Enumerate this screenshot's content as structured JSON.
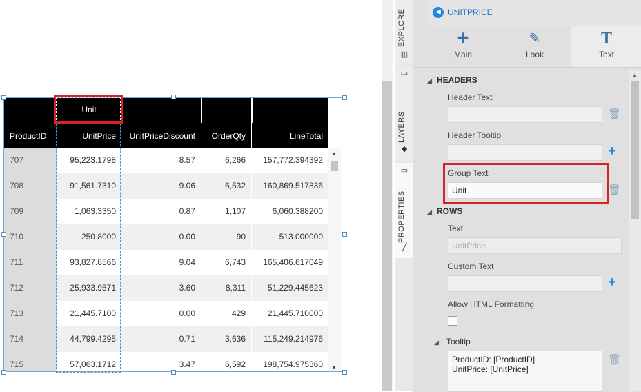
{
  "grid": {
    "group_header": "Unit",
    "columns": [
      "ProductID",
      "UnitPrice",
      "UnitPriceDiscount",
      "OrderQty",
      "LineTotal"
    ],
    "rows": [
      [
        "707",
        "95,223.1798",
        "8.57",
        "6,266",
        "157,772.394392"
      ],
      [
        "708",
        "91,561.7310",
        "9.06",
        "6,532",
        "160,869.517836"
      ],
      [
        "709",
        "1,063.3350",
        "0.87",
        "1,107",
        "6,060.388200"
      ],
      [
        "710",
        "250.8000",
        "0.00",
        "90",
        "513.000000"
      ],
      [
        "711",
        "93,827.8566",
        "9.04",
        "6,743",
        "165,406.617049"
      ],
      [
        "712",
        "25,933.9571",
        "3.60",
        "8,311",
        "51,229.445623"
      ],
      [
        "713",
        "21,445.7100",
        "0.00",
        "429",
        "21,445.710000"
      ],
      [
        "714",
        "44,799.4295",
        "0.71",
        "3,636",
        "115,249.214976"
      ],
      [
        "715",
        "57,063.1712",
        "3.47",
        "6,592",
        "198,754.975360"
      ]
    ]
  },
  "side_tabs": {
    "explore": "EXPLORE",
    "layers": "LAYERS",
    "properties": "PROPERTIES"
  },
  "panel": {
    "breadcrumb": "UNITPRICE",
    "tabs": [
      {
        "label": "Main",
        "icon": "puzzle-icon"
      },
      {
        "label": "Look",
        "icon": "eye-brush-icon"
      },
      {
        "label": "Text",
        "icon": "text-T-icon"
      }
    ],
    "headers": {
      "title": "HEADERS",
      "header_text_label": "Header Text",
      "header_text_value": "",
      "header_tooltip_label": "Header Tooltip",
      "group_text_label": "Group Text",
      "group_text_value": "Unit"
    },
    "rows": {
      "title": "ROWS",
      "text_label": "Text",
      "text_placeholder": "UnitPrice",
      "custom_text_label": "Custom Text",
      "allow_html_label": "Allow HTML Formatting",
      "tooltip_label": "Tooltip",
      "tooltip_value": "ProductID: [ProductID]\nUnitPrice: [UnitPrice]"
    }
  },
  "colors": {
    "accent": "#1e88e5",
    "highlight": "#d4242a",
    "header_bg": "#000000"
  }
}
